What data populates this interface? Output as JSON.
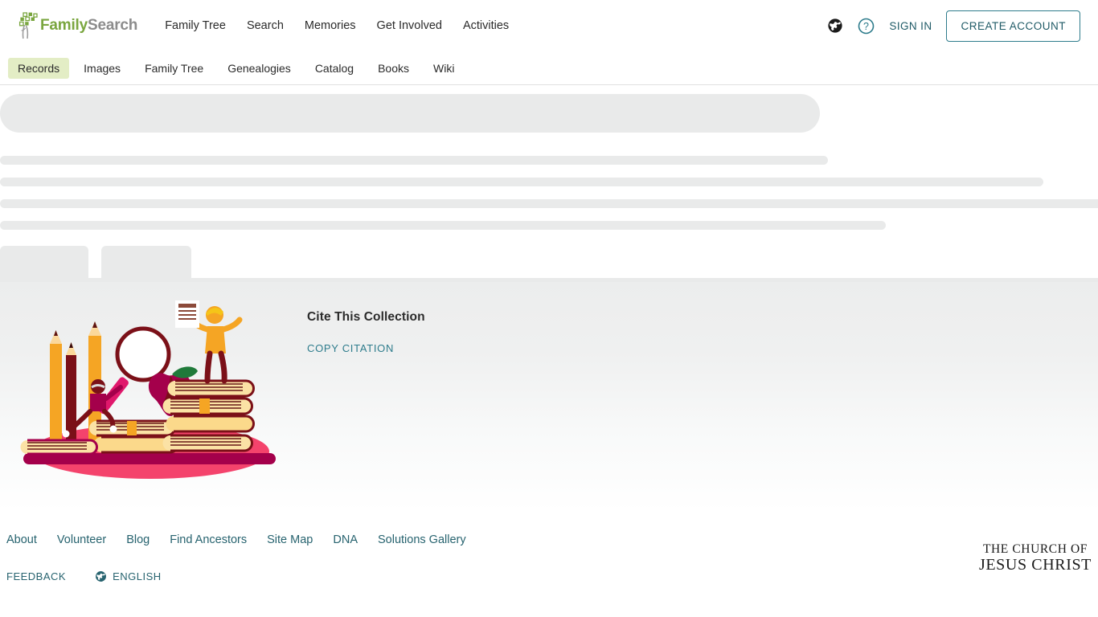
{
  "header": {
    "logo": {
      "icon": "family-tree-logo-icon",
      "text_primary": "Family",
      "text_secondary": "Search"
    },
    "nav": [
      {
        "label": "Family Tree",
        "name": "nav-family-tree"
      },
      {
        "label": "Search",
        "name": "nav-search"
      },
      {
        "label": "Memories",
        "name": "nav-memories"
      },
      {
        "label": "Get Involved",
        "name": "nav-get-involved"
      },
      {
        "label": "Activities",
        "name": "nav-activities"
      }
    ],
    "globe_icon": "globe-icon",
    "help_icon": "help-question-icon",
    "sign_in_label": "SIGN IN",
    "create_account_label": "CREATE ACCOUNT"
  },
  "subnav": {
    "items": [
      {
        "label": "Records",
        "active": true
      },
      {
        "label": "Images",
        "active": false
      },
      {
        "label": "Family Tree",
        "active": false
      },
      {
        "label": "Genealogies",
        "active": false
      },
      {
        "label": "Catalog",
        "active": false
      },
      {
        "label": "Books",
        "active": false
      },
      {
        "label": "Wiki",
        "active": false
      }
    ]
  },
  "cite": {
    "title": "Cite This Collection",
    "copy_label": "COPY CITATION",
    "illustration": "books-and-research-illustration"
  },
  "footer": {
    "links": [
      "About",
      "Volunteer",
      "Blog",
      "Find Ancestors",
      "Site Map",
      "DNA",
      "Solutions Gallery"
    ],
    "feedback_label": "FEEDBACK",
    "language_label": "ENGLISH",
    "language_icon": "globe-icon",
    "church_line1": "THE CHURCH OF",
    "church_line2": "JESUS CHRIST"
  },
  "colors": {
    "brand_green": "#7AA63F",
    "brand_gray": "#8C8C8C",
    "teal": "#2E7C8C",
    "footer_link": "#27636F",
    "active_tab_bg": "#E3EDC5",
    "skeleton": "#E9EAEA",
    "section_bg": "#ECEDED"
  }
}
